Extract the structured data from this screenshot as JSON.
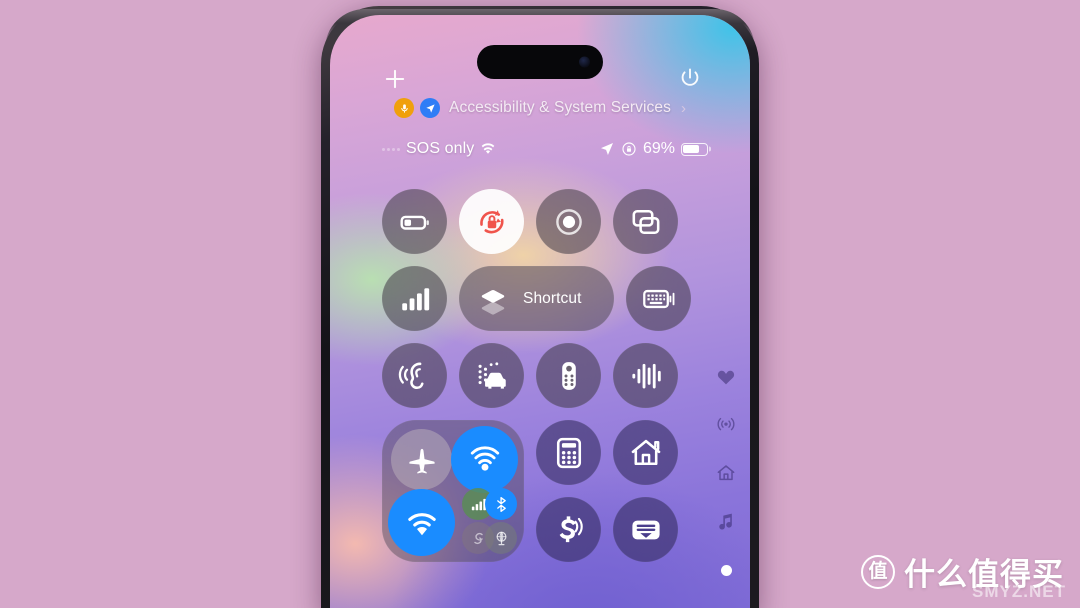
{
  "background": {
    "color": "#d6a8ca"
  },
  "device": {
    "name": "iPhone",
    "dynamic_island": "dynamic-island",
    "camera": "front-camera"
  },
  "control_center": {
    "add_control_label": "+",
    "power_label": "power",
    "privacy": {
      "mic_badge": "microphone-icon",
      "location_badge": "location-arrow-icon",
      "label": "Accessibility & System Services",
      "chevron": "›"
    },
    "status_bar": {
      "carrier": "SOS only",
      "wifi_icon": "wifi-icon",
      "location_icon": "location-arrow-icon",
      "rotation_lock_icon": "rotation-lock-icon",
      "battery_percent": "69%",
      "battery_level": 69
    },
    "rows": [
      {
        "tiles": [
          {
            "name": "low-power-mode",
            "icon": "battery-icon",
            "state": "off"
          },
          {
            "name": "rotation-lock",
            "icon": "rotation-lock-icon",
            "state": "on",
            "accent": "#f0544c"
          },
          {
            "name": "screen-recording",
            "icon": "record-icon",
            "state": "off"
          },
          {
            "name": "screen-mirroring",
            "icon": "screen-mirroring-icon",
            "state": "off"
          }
        ]
      },
      {
        "tiles": [
          {
            "name": "cellular-signal",
            "icon": "signal-bars-icon",
            "state": "off"
          },
          {
            "name": "shortcut",
            "icon": "shortcut-stack-icon",
            "label": "Shortcut",
            "wide": true
          },
          {
            "name": "keyboard-dictation",
            "icon": "keyboard-icon",
            "state": "off"
          }
        ]
      },
      {
        "tiles": [
          {
            "name": "hearing",
            "icon": "ear-icon",
            "state": "off"
          },
          {
            "name": "sound-recognition",
            "icon": "car-detection-icon",
            "state": "off"
          },
          {
            "name": "apple-tv-remote",
            "icon": "tv-remote-icon",
            "state": "off"
          },
          {
            "name": "voice-memos",
            "icon": "waveform-icon",
            "state": "off"
          }
        ]
      },
      {
        "tiles": [
          {
            "name": "connectivity-module",
            "module": true
          },
          {
            "name": "calculator",
            "icon": "calculator-icon",
            "state": "off"
          },
          {
            "name": "home",
            "icon": "home-icon",
            "state": "off"
          },
          {
            "name": "tap-to-pay",
            "icon": "tap-to-pay-icon",
            "state": "off"
          },
          {
            "name": "wallet",
            "icon": "wallet-icon",
            "state": "off"
          }
        ]
      }
    ],
    "connectivity": {
      "airplane_mode": {
        "icon": "airplane-icon",
        "state": "off"
      },
      "airdrop": {
        "icon": "airdrop-icon",
        "state": "on",
        "color": "#1a8cff"
      },
      "wifi": {
        "icon": "wifi-icon",
        "state": "on",
        "color": "#1a8cff"
      },
      "cellular_data": {
        "icon": "signal-bars-icon",
        "state": "on",
        "color": "#5c8c56"
      },
      "bluetooth": {
        "icon": "bluetooth-icon",
        "state": "on",
        "color": "#1a8cff"
      },
      "personal_hotspot": {
        "icon": "hotspot-icon",
        "state": "off"
      },
      "vpn": {
        "icon": "vpn-globe-icon",
        "state": "off"
      }
    },
    "page_rail": [
      {
        "name": "favorites",
        "icon": "heart-icon"
      },
      {
        "name": "connectivity-page",
        "icon": "antenna-icon"
      },
      {
        "name": "home-page",
        "icon": "home-icon"
      },
      {
        "name": "media-page",
        "icon": "music-note-icon"
      }
    ],
    "page_indicator": {
      "current": 1,
      "icon": "page-dot"
    }
  },
  "watermark": {
    "logo_char": "值",
    "text": "什么值得买",
    "subtext": "SMYZ.NET"
  }
}
